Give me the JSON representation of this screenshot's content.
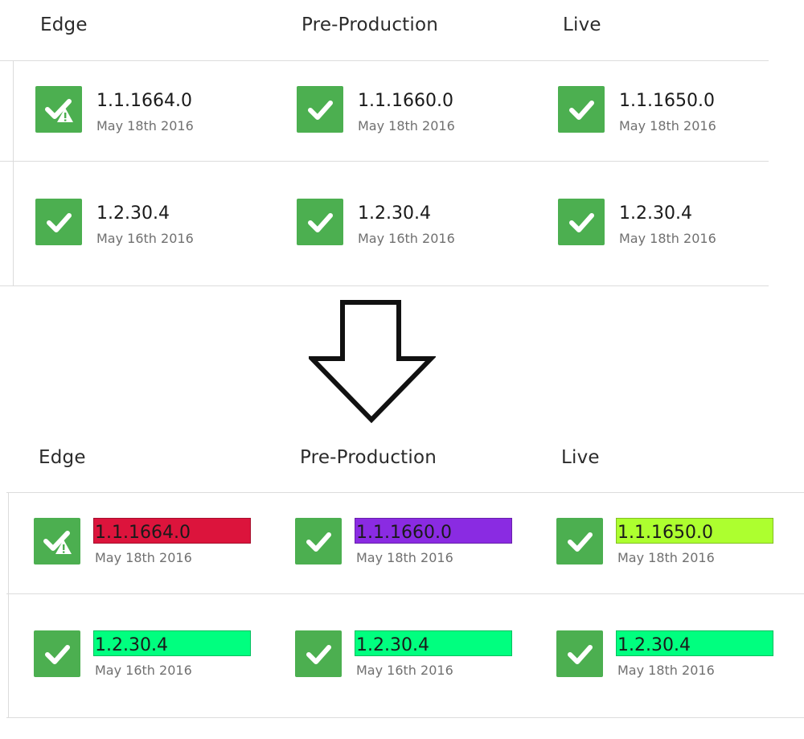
{
  "headers": [
    "Edge",
    "Pre-Production",
    "Live"
  ],
  "rows": [
    [
      {
        "version": "1.1.1664.0",
        "date": "May 18th 2016",
        "icon": "check-warning-icon"
      },
      {
        "version": "1.1.1660.0",
        "date": "May 18th 2016",
        "icon": "check-icon"
      },
      {
        "version": "1.1.1650.0",
        "date": "May 18th 2016",
        "icon": "check-icon"
      }
    ],
    [
      {
        "version": "1.2.30.4",
        "date": "May 16th 2016",
        "icon": "check-icon"
      },
      {
        "version": "1.2.30.4",
        "date": "May 16th 2016",
        "icon": "check-icon"
      },
      {
        "version": "1.2.30.4",
        "date": "May 18th 2016",
        "icon": "check-icon"
      }
    ]
  ],
  "highlights": [
    [
      "#dc143c",
      "#8a2be2",
      "#adff2f"
    ],
    [
      "#00ff7f",
      "#00ff7f",
      "#00ff7f"
    ]
  ],
  "colors": {
    "status_green": "#4caf50",
    "divider": "#dcdcdc"
  },
  "arrow_icon": "down-arrow-icon"
}
